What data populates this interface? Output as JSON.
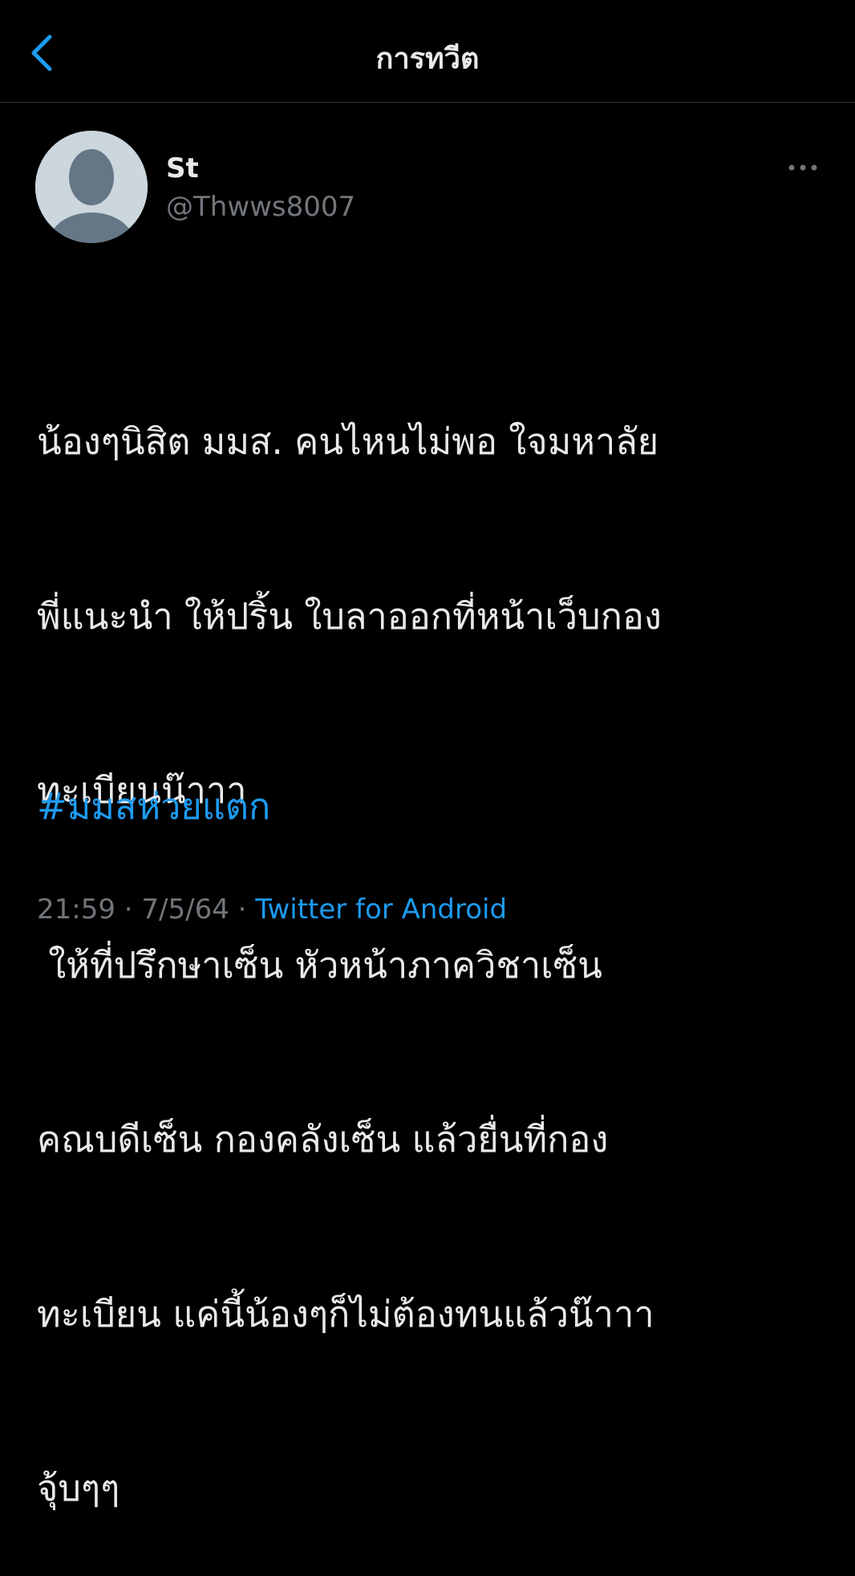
{
  "header": {
    "title": "การทวีต",
    "back_icon": "chevron-left-icon"
  },
  "colors": {
    "background": "#000000",
    "text": "#e7e9ea",
    "secondary_text": "#71767b",
    "accent": "#1d9bf0",
    "divider": "#2f3336",
    "avatar_bg": "#ccd6dd",
    "avatar_silhouette": "#657786"
  },
  "tweet": {
    "author": {
      "display_name": "St",
      "handle": "@Thwws8007",
      "avatar_icon": "default-avatar-icon"
    },
    "more_icon": "more-horizontal-icon",
    "text_lines": [
      "น้องๆนิสิต มมส. คนไหนไม่พอ ใจมหาลัย",
      "พี่แนะนำ ให้ปริ้น ใบลาออกที่หน้าเว็บกอง",
      "ทะเบียนน๊าาา",
      " ให้ที่ปรึกษาเซ็น หัวหน้าภาควิชาเซ็น",
      "คณบดีเซ็น กองคลังเซ็น แล้วยื่นที่กอง",
      "ทะเบียน แค่นี้น้องๆก็ไม่ต้องทนแล้วน๊าาา",
      "จุ้บๆๆ"
    ],
    "hashtag": "#มมสห่วยแตก",
    "time": "21:59",
    "separator": "·",
    "date": "7/5/64",
    "source": "Twitter for Android"
  }
}
